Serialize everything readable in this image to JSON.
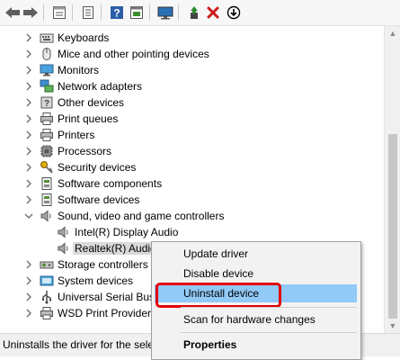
{
  "toolbar": {
    "buttons": [
      {
        "name": "back-arrow-icon",
        "color": "#5f5f5f"
      },
      {
        "name": "forward-arrow-icon",
        "color": "#5f5f5f"
      },
      {
        "name": "properties-icon",
        "color": "#5f5f5f"
      },
      {
        "name": "document-icon",
        "color": "#5f5f5f"
      },
      {
        "name": "help-icon",
        "color": "#2b5faa"
      },
      {
        "name": "update-driver-icon",
        "color": "#3e8d2f"
      },
      {
        "name": "monitor-scan-icon",
        "color": "#2a70b6"
      },
      {
        "name": "enable-device-icon",
        "color": "#2f8a2f"
      },
      {
        "name": "uninstall-x-icon",
        "color": "#cc1d1d"
      },
      {
        "name": "download-circle-icon",
        "color": "#000000"
      }
    ]
  },
  "tree": {
    "items": [
      {
        "label": "Keyboards",
        "icon": "keyboard-icon",
        "expanded": false
      },
      {
        "label": "Mice and other pointing devices",
        "icon": "mouse-icon",
        "expanded": false
      },
      {
        "label": "Monitors",
        "icon": "monitor-icon",
        "expanded": false
      },
      {
        "label": "Network adapters",
        "icon": "network-icon",
        "expanded": false
      },
      {
        "label": "Other devices",
        "icon": "other-devices-icon",
        "expanded": false
      },
      {
        "label": "Print queues",
        "icon": "printer-icon",
        "expanded": false
      },
      {
        "label": "Printers",
        "icon": "printer-icon",
        "expanded": false
      },
      {
        "label": "Processors",
        "icon": "processor-icon",
        "expanded": false
      },
      {
        "label": "Security devices",
        "icon": "security-key-icon",
        "expanded": false
      },
      {
        "label": "Software components",
        "icon": "software-icon",
        "expanded": false
      },
      {
        "label": "Software devices",
        "icon": "software-icon",
        "expanded": false
      },
      {
        "label": "Sound, video and game controllers",
        "icon": "speaker-icon",
        "expanded": true
      },
      {
        "label": "Intel(R) Display Audio",
        "icon": "speaker-icon",
        "child": true
      },
      {
        "label": "Realtek(R) Audio",
        "icon": "speaker-icon",
        "child": true,
        "selected": true
      },
      {
        "label": "Storage controllers",
        "icon": "storage-icon",
        "expanded": false
      },
      {
        "label": "System devices",
        "icon": "system-icon",
        "expanded": false
      },
      {
        "label": "Universal Serial Bus",
        "icon": "usb-icon",
        "expanded": false
      },
      {
        "label": "WSD Print Provider",
        "icon": "printer-icon",
        "expanded": false
      }
    ]
  },
  "context_menu": {
    "update_driver": "Update driver",
    "disable_device": "Disable device",
    "uninstall_device": "Uninstall device",
    "scan_hardware": "Scan for hardware changes",
    "properties": "Properties"
  },
  "statusbar": {
    "text": "Uninstalls the driver for the selected device."
  },
  "colors": {
    "highlight": "#91c9f7",
    "annotation_box": "#e30000"
  }
}
